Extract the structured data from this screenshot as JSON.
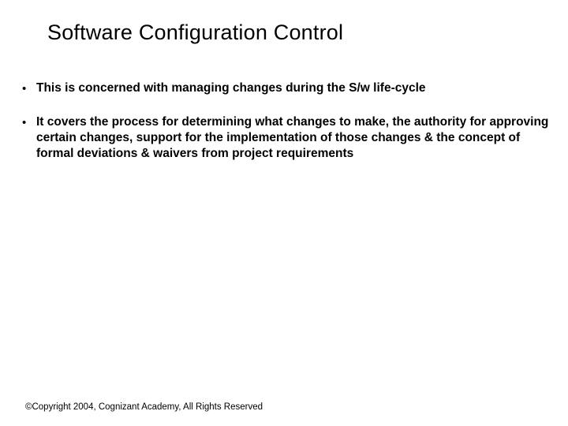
{
  "slide": {
    "title": "Software Configuration Control",
    "bullets": [
      {
        "text": "This is concerned with managing changes during the S/w life-cycle"
      },
      {
        "text": "It covers the process for determining what changes to make, the authority for approving certain changes, support for the implementation of those changes & the concept of formal deviations & waivers from project requirements"
      }
    ],
    "footer": "©Copyright 2004, Cognizant Academy, All Rights Reserved"
  }
}
